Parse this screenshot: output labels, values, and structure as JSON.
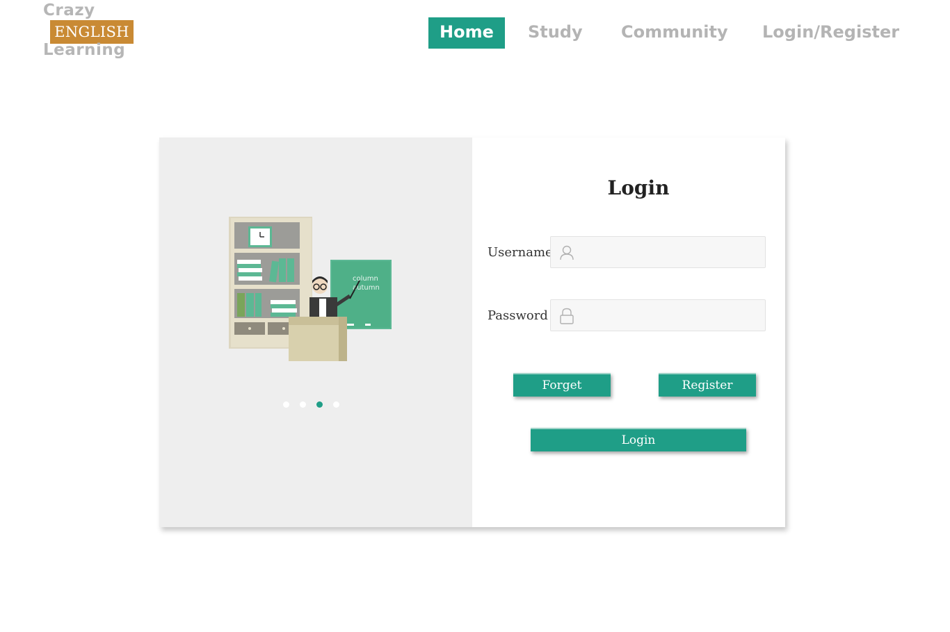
{
  "logo": {
    "line1": "Crazy",
    "badge": "ENGLISH",
    "line2": "Learning"
  },
  "nav": {
    "items": [
      {
        "label": "Home",
        "active": true
      },
      {
        "label": "Study"
      },
      {
        "label": "Community"
      },
      {
        "label": "Login/Register"
      }
    ]
  },
  "illustration": {
    "board_text_line1": "column",
    "board_text_line2": "autumn"
  },
  "carousel": {
    "count": 4,
    "active_index": 2
  },
  "login": {
    "title": "Login",
    "username_label": "Username",
    "username_value": "",
    "password_label": "Password",
    "password_value": "",
    "forget_label": "Forget",
    "register_label": "Register",
    "submit_label": "Login"
  },
  "colors": {
    "accent": "#1f9e87",
    "logo_badge": "#c98a34",
    "nav_inactive": "#b4b4b4",
    "panel_bg": "#eeeeee"
  }
}
